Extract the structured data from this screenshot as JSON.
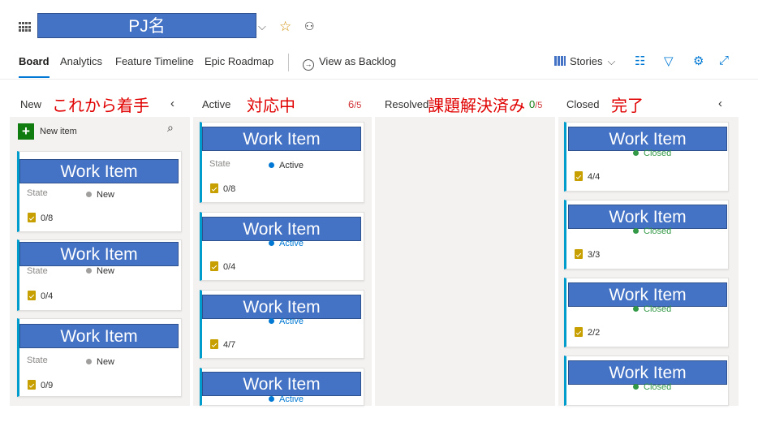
{
  "header": {
    "project_name": "PJ名"
  },
  "nav": {
    "tabs": [
      "Board",
      "Analytics",
      "Feature Timeline",
      "Epic Roadmap"
    ],
    "view_as_backlog": "View as Backlog",
    "stories": "Stories"
  },
  "columns": {
    "new": {
      "name": "New",
      "label_jp": "これから着手"
    },
    "active": {
      "name": "Active",
      "label_jp": "対応中",
      "count": "6",
      "limit": "/5"
    },
    "resolved": {
      "name": "Resolved",
      "label_jp": "課題解決済み",
      "count": "0",
      "limit": "/5"
    },
    "closed": {
      "name": "Closed",
      "label_jp": "完了"
    }
  },
  "new_item_label": "New item",
  "state_label": "State",
  "work_item_title": "Work Item",
  "cards": {
    "new": [
      {
        "state": "New",
        "tasks": "0/8"
      },
      {
        "state": "New",
        "tasks": "0/4"
      },
      {
        "state": "New",
        "tasks": "0/9"
      }
    ],
    "active": [
      {
        "state": "Active",
        "tasks": "0/8"
      },
      {
        "state": "Active",
        "tasks": "0/4"
      },
      {
        "state": "Active",
        "tasks": "4/7"
      },
      {
        "state": "Active",
        "tasks": ""
      }
    ],
    "closed": [
      {
        "state": "Closed",
        "tasks": "4/4"
      },
      {
        "state": "Closed",
        "tasks": "3/3"
      },
      {
        "state": "Closed",
        "tasks": "2/2"
      },
      {
        "state": "Closed",
        "tasks": ""
      }
    ]
  },
  "colors": {
    "accent": "#0078d4",
    "card_border": "#009ccc",
    "banner": "#4472c4",
    "red_text": "#e00000",
    "new_dot": "#a19f9d",
    "active_dot": "#0078d4",
    "closed_dot": "#339947",
    "limit_over": "#d13438",
    "limit_ok": "#107c10"
  },
  "icons": {
    "board": "board-grid-icon",
    "chevron": "chevron-down-icon",
    "favorite": "star-icon",
    "team": "team-members-icon",
    "backlog": "arrow-circle-icon",
    "stories": "stories-icon",
    "settings": "settings-sliders-icon",
    "filter": "filter-icon",
    "gear": "gear-icon",
    "expand": "expand-icon",
    "collapse": "chevron-left-icon",
    "add": "plus-icon",
    "search": "search-icon",
    "task": "task-checklist-icon"
  }
}
